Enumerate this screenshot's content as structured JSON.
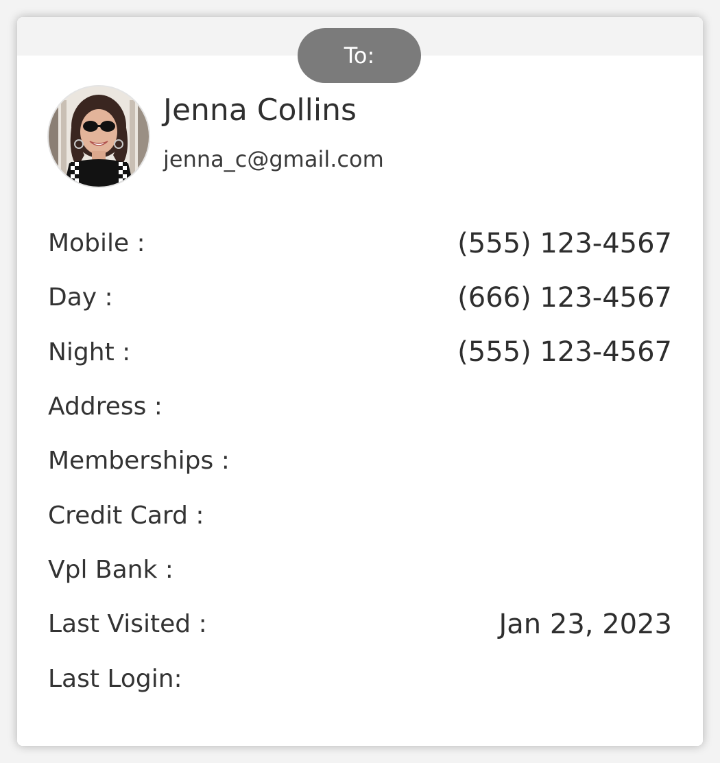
{
  "header": {
    "to_label": "To:"
  },
  "contact": {
    "name": "Jenna Collins",
    "email": "jenna_c@gmail.com",
    "avatar_icon": "profile-photo"
  },
  "details": [
    {
      "label": "Mobile :",
      "value": "(555) 123-4567"
    },
    {
      "label": "Day :",
      "value": "(666) 123-4567"
    },
    {
      "label": "Night :",
      "value": "(555) 123-4567"
    },
    {
      "label": "Address :",
      "value": ""
    },
    {
      "label": "Memberships :",
      "value": ""
    },
    {
      "label": "Credit Card :",
      "value": ""
    },
    {
      "label": "Vpl Bank :",
      "value": ""
    },
    {
      "label": "Last Visited :",
      "value": "Jan 23, 2023"
    },
    {
      "label": "Last Login:",
      "value": ""
    }
  ],
  "colors": {
    "pill": "#7b7b7b",
    "text": "#333333",
    "background": "#ffffff"
  }
}
